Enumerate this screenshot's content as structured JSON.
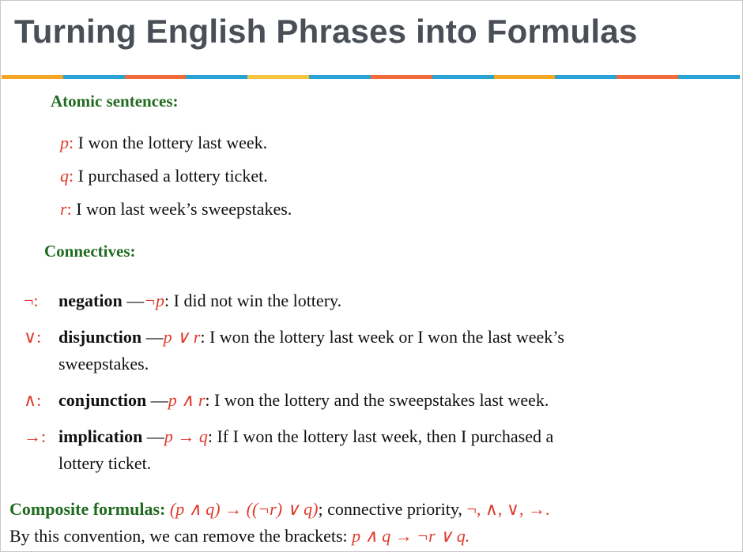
{
  "slide": {
    "title": "Turning English Phrases into Formulas",
    "stripe_colors": [
      "#f5a623",
      "#29a3d4",
      "#f26b3a",
      "#29a3d4",
      "#f5c542",
      "#29a3d4",
      "#f26b3a",
      "#29a3d4",
      "#f5a623",
      "#29a3d4",
      "#f26b3a",
      "#29a3d4"
    ]
  },
  "atomic": {
    "heading": "Atomic sentences:",
    "items": [
      {
        "var": "p",
        "colon": ":",
        "text": "I won the lottery last week."
      },
      {
        "var": "q",
        "colon": ":",
        "text": "I purchased a lottery ticket."
      },
      {
        "var": "r",
        "colon": ":",
        "text": "I won last week’s sweepstakes."
      }
    ]
  },
  "connectives": {
    "heading": "Connectives:",
    "items": [
      {
        "symbol": "¬:",
        "name": "negation",
        "dash": " —",
        "formula": "¬p",
        "rest": ": I did not win the lottery.",
        "cont": ""
      },
      {
        "symbol": "∨:",
        "name": "disjunction",
        "dash": " —",
        "formula": "p ∨ r",
        "rest": ": I won the lottery last week or I won the last week’s",
        "cont": "sweepstakes."
      },
      {
        "symbol": "∧:",
        "name": "conjunction",
        "dash": " —",
        "formula": "p ∧ r",
        "rest": ": I won the lottery and the sweepstakes last week.",
        "cont": ""
      },
      {
        "symbol": "→:",
        "name": "implication",
        "dash": " —",
        "formula": "p → q",
        "rest": ":  If I won the lottery last week, then I purchased a",
        "cont": "lottery ticket."
      }
    ]
  },
  "composite": {
    "label": "Composite formulas:",
    "formula": "(p ∧ q) → ((¬r) ∨ q)",
    "text1": "; connective priority, ",
    "priority": "¬, ∧, ∨, →.",
    "line2_text": "By this convention, we can remove the brackets: ",
    "line2_formula": "p ∧ q → ¬r ∨ q."
  }
}
